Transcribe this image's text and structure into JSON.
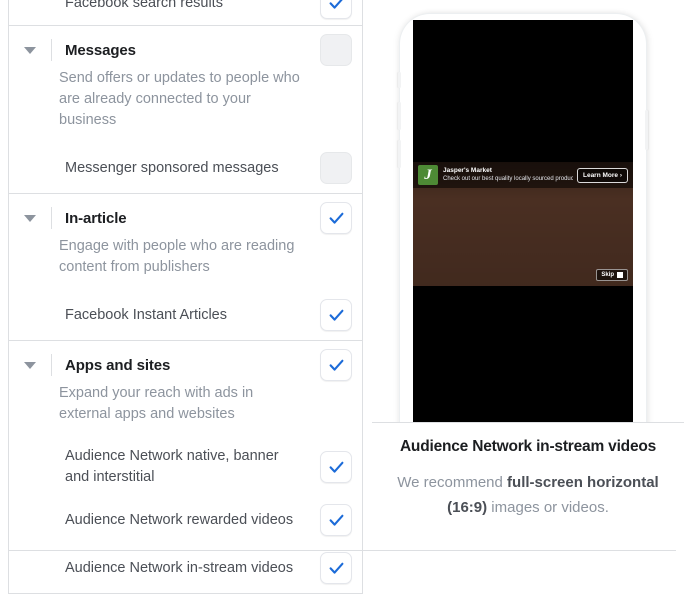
{
  "placements": {
    "top_item": {
      "label": "Facebook search results",
      "checked": true
    },
    "sections": [
      {
        "title": "Messages",
        "description": "Send offers or updates to people who are already connected to your business",
        "checked": false,
        "caret": "chevron-down-icon",
        "children": [
          {
            "label": "Messenger sponsored messages",
            "checked": false
          }
        ]
      },
      {
        "title": "In-article",
        "description": "Engage with people who are reading content from publishers",
        "checked": true,
        "caret": "chevron-down-icon",
        "children": [
          {
            "label": "Facebook Instant Articles",
            "checked": true
          }
        ]
      },
      {
        "title": "Apps and sites",
        "description": "Expand your reach with ads in external apps and websites",
        "checked": true,
        "caret": "chevron-down-icon",
        "children": [
          {
            "label": "Audience Network native, banner and interstitial",
            "checked": true
          },
          {
            "label": "Audience Network rewarded videos",
            "checked": true
          },
          {
            "label": "Audience Network in-stream videos",
            "checked": true
          }
        ]
      }
    ]
  },
  "preview": {
    "device": "iphone-mockup",
    "ad": {
      "logo_letter": "J",
      "advertiser": "Jasper's Market",
      "tagline": "Check out our best quality locally sourced products",
      "cta_label": "Learn More ›",
      "skip_label": "Skip"
    },
    "caption": {
      "title": "Audience Network in-stream videos",
      "body_prefix": "We recommend ",
      "body_strong_1": "full-screen horizontal (16:9)",
      "body_suffix": " images or videos."
    }
  },
  "colors": {
    "accent_blue": "#1877f2",
    "check_blue": "#1c6bd8",
    "border": "#dddfe2",
    "muted_text": "#8d949e",
    "body_text": "#4b4f56",
    "heading_text": "#1c1e21",
    "checkbox_off_bg": "#f0f1f3",
    "logo_green": "#4e8a35"
  }
}
